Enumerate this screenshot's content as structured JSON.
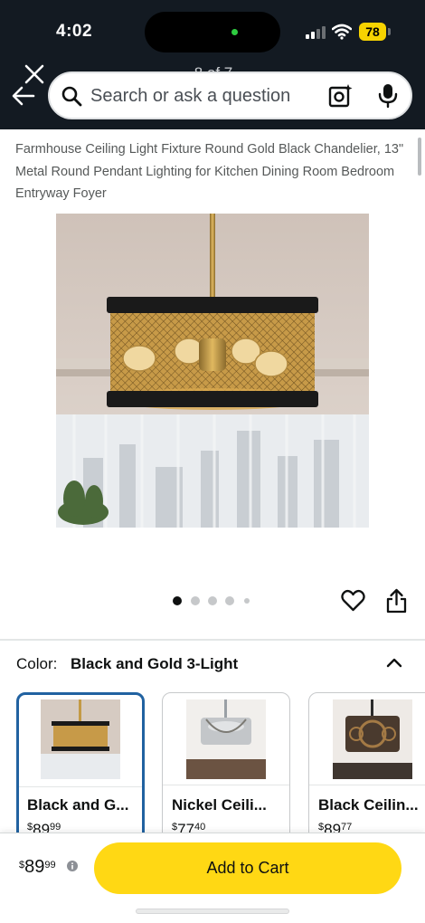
{
  "status_bar": {
    "time": "4:02",
    "battery": "78"
  },
  "header": {
    "page_counter": "8 of 7",
    "search": {
      "placeholder": "Search or ask a question"
    },
    "icons": [
      "close-icon",
      "back-arrow-icon",
      "search-icon",
      "camera-scan-icon",
      "microphone-icon"
    ]
  },
  "product": {
    "title": "Farmhouse Ceiling Light Fixture Round Gold Black Chandelier, 13\" Metal Round Pendant Lighting for Kitchen Dining Room Bedroom Entryway Foyer",
    "image_alt": "Round black and gold mesh drum pendant light with exposed bulbs",
    "image_count": 5,
    "current_image": 1
  },
  "color_selector": {
    "label": "Color:",
    "selected": "Black and Gold 3-Light",
    "variants": [
      {
        "name": "Black and G...",
        "price_symbol": "$",
        "price_whole": "89",
        "price_fraction": "99",
        "selected": true
      },
      {
        "name": "Nickel Ceili...",
        "price_symbol": "$",
        "price_whole": "77",
        "price_fraction": "40",
        "selected": false
      },
      {
        "name": "Black Ceilin...",
        "price_symbol": "$",
        "price_whole": "89",
        "price_fraction": "77",
        "selected": false
      }
    ]
  },
  "buy_bar": {
    "price_symbol": "$",
    "price_whole": "89",
    "price_fraction": "99",
    "add_to_cart_label": "Add to Cart"
  },
  "colors": {
    "header_bg": "#131a22",
    "add_to_cart": "#ffd814",
    "selected_border": "#2162a1",
    "battery": "#f7d300"
  }
}
